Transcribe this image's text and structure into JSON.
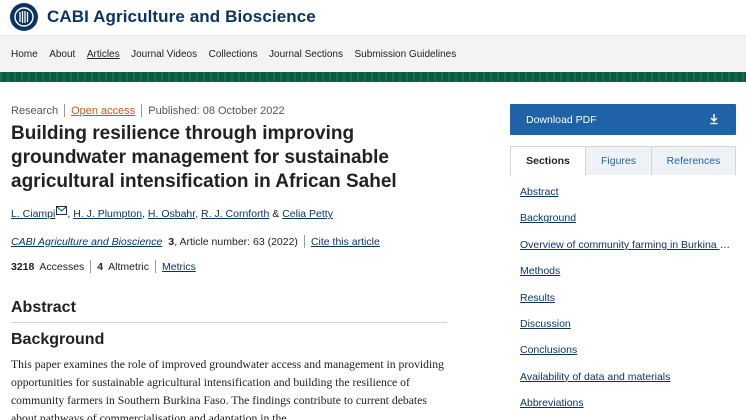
{
  "header": {
    "journal_title": "CABI Agriculture and Bioscience"
  },
  "nav": {
    "items": [
      "Home",
      "About",
      "Articles",
      "Journal Videos",
      "Collections",
      "Journal Sections",
      "Submission Guidelines"
    ],
    "active": "Articles"
  },
  "article": {
    "type": "Research",
    "access": "Open access",
    "published": "Published: 08 October 2022",
    "title": "Building resilience through improving groundwater management for sustainable agricultural intensification in African Sahel",
    "authors": [
      "L. Ciampi",
      "H. J. Plumpton",
      "H. Osbahr",
      "R. J. Cornforth",
      "Celia Petty"
    ],
    "author_sep": ",",
    "author_and": "&",
    "journal": "CABI Agriculture and Bioscience",
    "volume": "3",
    "article_number": ", Article number: 63 (2022)",
    "cite_label": "Cite this article",
    "accesses_count": "3218",
    "accesses_label": "Accesses",
    "altmetric_count": "4",
    "altmetric_label": "Altmetric",
    "metrics_label": "Metrics"
  },
  "abstract": {
    "heading": "Abstract",
    "subheading": "Background",
    "text": "This paper examines the role of improved groundwater access and management in providing opportunities for sustainable agricultural intensification and building the resilience of community farmers in Southern Burkina Faso. The findings contribute to current debates about pathways of commercialisation and adaptation in the"
  },
  "sidebar": {
    "download_label": "Download PDF",
    "download_icon": "download-icon",
    "tabs": [
      "Sections",
      "Figures",
      "References"
    ],
    "selected_tab": "Sections",
    "sections": [
      "Abstract",
      "Background",
      "Overview of community farming in Burkina Faso",
      "Methods",
      "Results",
      "Discussion",
      "Conclusions",
      "Availability of data and materials",
      "Abbreviations"
    ]
  },
  "colors": {
    "brand_navy": "#0c3463",
    "band_green": "#0b5c45",
    "open_access_orange": "#c9581b",
    "pdf_button_blue": "#1f62a8"
  }
}
